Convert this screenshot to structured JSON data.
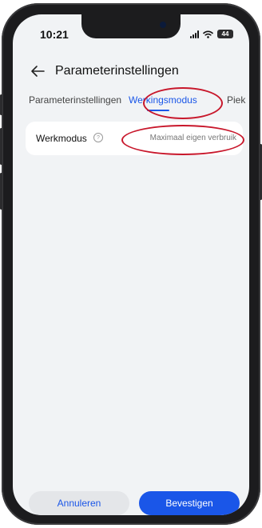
{
  "status_bar": {
    "time": "10:21",
    "battery": "44"
  },
  "header": {
    "title": "Parameterinstellingen"
  },
  "tabs": [
    {
      "label": "Parameterinstellingen",
      "active": false
    },
    {
      "label": "Werkingsmodus",
      "active": true
    },
    {
      "label": "Piek",
      "active": false
    }
  ],
  "setting": {
    "label": "Werkmodus",
    "value": "Maximaal eigen verbruik"
  },
  "footer": {
    "cancel_label": "Annuleren",
    "confirm_label": "Bevestigen"
  },
  "colors": {
    "accent": "#1a56e8",
    "annotation": "#c8172b",
    "background": "#f1f3f5"
  },
  "icons": {
    "back": "arrow-left-icon",
    "help": "question-circle-icon",
    "signal": "signal-icon",
    "wifi": "wifi-icon",
    "battery": "battery-icon"
  }
}
